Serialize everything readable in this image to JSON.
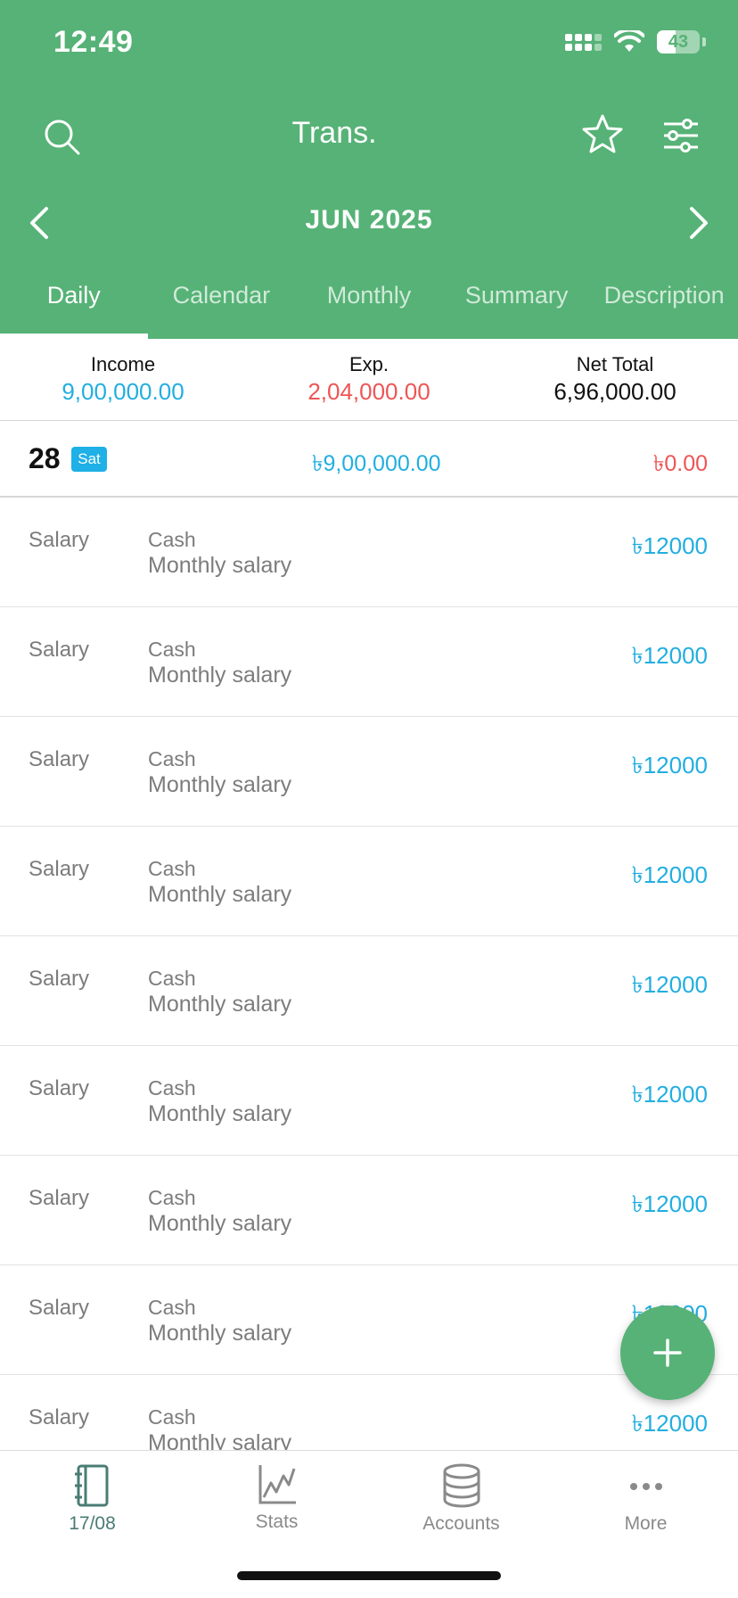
{
  "status_bar": {
    "time": "12:49",
    "battery": "43"
  },
  "header": {
    "title": "Trans.",
    "month": "JUN 2025",
    "tabs": [
      {
        "label": "Daily",
        "active": true
      },
      {
        "label": "Calendar",
        "active": false
      },
      {
        "label": "Monthly",
        "active": false
      },
      {
        "label": "Summary",
        "active": false
      },
      {
        "label": "Description",
        "active": false
      }
    ]
  },
  "summary": {
    "income_label": "Income",
    "income_value": "9,00,000.00",
    "expense_label": "Exp.",
    "expense_value": "2,04,000.00",
    "net_label": "Net Total",
    "net_value": "6,96,000.00"
  },
  "day": {
    "date": "28",
    "weekday": "Sat",
    "income": "৳9,00,000.00",
    "expense": "৳0.00"
  },
  "transactions": [
    {
      "category": "Salary",
      "account": "Cash",
      "note": "Monthly salary",
      "amount": "৳12000"
    },
    {
      "category": "Salary",
      "account": "Cash",
      "note": "Monthly salary",
      "amount": "৳12000"
    },
    {
      "category": "Salary",
      "account": "Cash",
      "note": "Monthly salary",
      "amount": "৳12000"
    },
    {
      "category": "Salary",
      "account": "Cash",
      "note": "Monthly salary",
      "amount": "৳12000"
    },
    {
      "category": "Salary",
      "account": "Cash",
      "note": "Monthly salary",
      "amount": "৳12000"
    },
    {
      "category": "Salary",
      "account": "Cash",
      "note": "Monthly salary",
      "amount": "৳12000"
    },
    {
      "category": "Salary",
      "account": "Cash",
      "note": "Monthly salary",
      "amount": "৳12000"
    },
    {
      "category": "Salary",
      "account": "Cash",
      "note": "Monthly salary",
      "amount": "৳12000"
    },
    {
      "category": "Salary",
      "account": "Cash",
      "note": "Monthly salary",
      "amount": "৳12000"
    }
  ],
  "bottom_nav": [
    {
      "label": "17/08",
      "icon": "notebook-icon",
      "active": true
    },
    {
      "label": "Stats",
      "icon": "chart-icon",
      "active": false
    },
    {
      "label": "Accounts",
      "icon": "database-icon",
      "active": false
    },
    {
      "label": "More",
      "icon": "more-icon",
      "active": false
    }
  ],
  "colors": {
    "brand": "#56b276",
    "income": "#22aee0",
    "expense": "#ee5555"
  }
}
